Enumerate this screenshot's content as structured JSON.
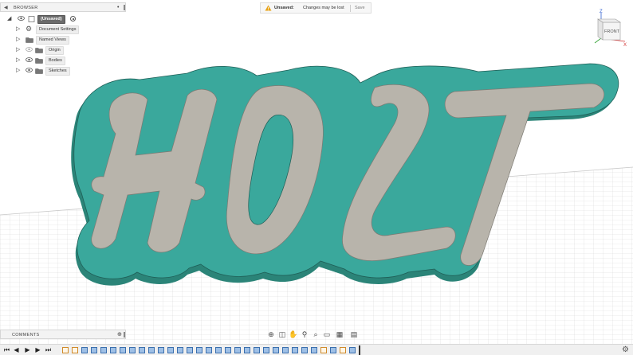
{
  "browser": {
    "title": "BROWSER",
    "document_name": "(Unsaved)",
    "items": [
      {
        "label": "Document Settings",
        "icon": "gear-icon"
      },
      {
        "label": "Named Views",
        "icon": "folder-icon"
      },
      {
        "label": "Origin",
        "icon": "folder-icon"
      },
      {
        "label": "Bodies",
        "icon": "folder-icon"
      },
      {
        "label": "Sketches",
        "icon": "folder-icon"
      }
    ]
  },
  "notice": {
    "status": "Unsaved:",
    "message": "Changes may be lost",
    "save_label": "Save"
  },
  "viewcube": {
    "axis_z": "Z",
    "axis_x": "X",
    "face_label": "FRONT"
  },
  "model": {
    "text": "HOLT",
    "body_color": "#3aa89c",
    "face_color": "#b8b4ab"
  },
  "comments": {
    "title": "COMMENTS"
  },
  "colors": {
    "accent": "#3aa89c",
    "warning": "#e8a317"
  }
}
